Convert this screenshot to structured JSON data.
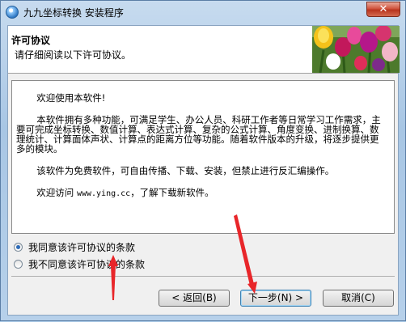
{
  "window": {
    "title": "九九坐标转换 安装程序",
    "close_glyph": "✕"
  },
  "header": {
    "title": "许可协议",
    "subtitle": "请仔细阅读以下许可协议。"
  },
  "license": {
    "paragraphs": [
      "欢迎使用本软件!",
      "本软件拥有多种功能，可满足学生、办公人员、科研工作者等日常学习工作需求，主要可完成坐标转换、数值计算、表达式计算、复杂的公式计算、角度变换、进制换算、数理统计、计算面体声状、计算点的距离方位等功能。随着软件版本的升级，将逐步提供更多的模块。",
      "该软件为免费软件，可自由传播、下载、安装，但禁止进行反汇编操作。"
    ],
    "visit_prefix": "欢迎访问 ",
    "visit_url": "www.ying.cc",
    "visit_suffix": "，了解下载新软件。"
  },
  "options": {
    "agree": "我同意该许可协议的条款",
    "disagree": "我不同意该许可协议的条款",
    "selected": "agree"
  },
  "buttons": {
    "back": "< 返回(B)",
    "next": "下一步(N) >",
    "cancel": "取消(C)"
  },
  "colors": {
    "annotation_arrow": "#e8262a"
  }
}
